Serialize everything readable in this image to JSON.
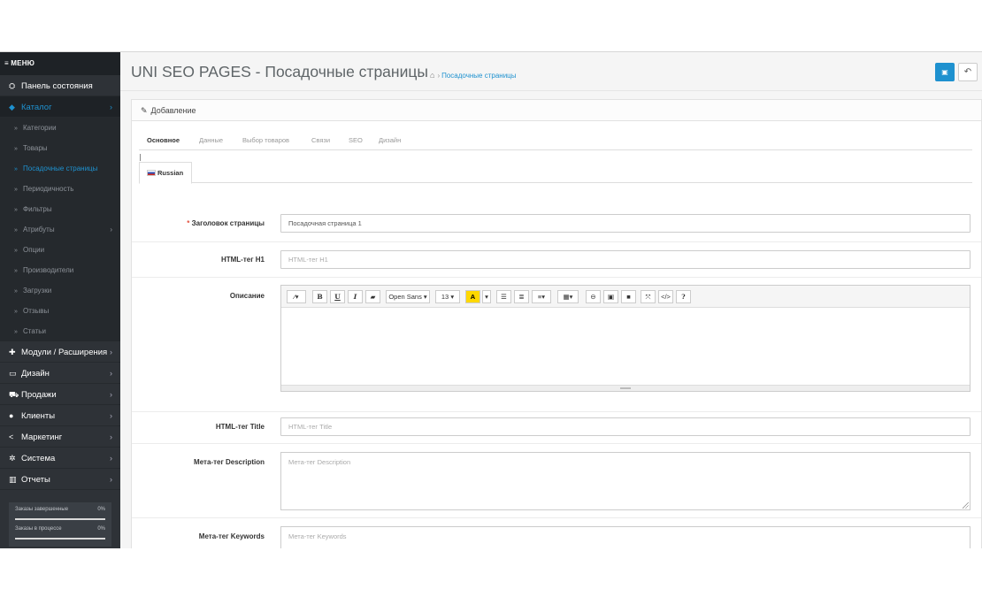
{
  "sidebar": {
    "menu_label": "≡ МЕНЮ",
    "items": [
      {
        "label": "Панель состояния",
        "icon": "dashboard-icon",
        "glyph": "⛭"
      },
      {
        "label": "Каталог",
        "icon": "tag-icon",
        "glyph": "◆",
        "active": true
      },
      {
        "label": "Модули / Расширения",
        "icon": "puzzle-icon",
        "glyph": "✚"
      },
      {
        "label": "Дизайн",
        "icon": "monitor-icon",
        "glyph": "▭"
      },
      {
        "label": "Продажи",
        "icon": "cart-icon",
        "glyph": "⛟"
      },
      {
        "label": "Клиенты",
        "icon": "user-icon",
        "glyph": "●"
      },
      {
        "label": "Маркетинг",
        "icon": "share-icon",
        "glyph": "<"
      },
      {
        "label": "Система",
        "icon": "cog-icon",
        "glyph": "✲"
      },
      {
        "label": "Отчеты",
        "icon": "bar-chart-icon",
        "glyph": "▥"
      }
    ],
    "catalog_sub": [
      "Категории",
      "Товары",
      "Посадочные страницы",
      "Периодичность",
      "Фильтры",
      "Атрибуты",
      "Опции",
      "Производители",
      "Загрузки",
      "Отзывы",
      "Статьи"
    ],
    "stats": [
      {
        "label": "Заказы завершенные",
        "value": "0%"
      },
      {
        "label": "Заказы в процессе",
        "value": "0%"
      }
    ]
  },
  "header": {
    "title": "UNI SEO PAGES - Посадочные страницы",
    "breadcrumb": "Посадочные страницы"
  },
  "panel": {
    "heading": "Добавление",
    "tabs": [
      "Основное",
      "Данные",
      "Выбор товаров",
      "Связи",
      "SEO",
      "Дизайн"
    ],
    "language": "Russian"
  },
  "form": {
    "page_title": {
      "label": "Заголовок страницы",
      "value": "Посадочная страница 1"
    },
    "h1": {
      "label": "HTML-тег H1",
      "placeholder": "HTML-тег H1"
    },
    "description": {
      "label": "Описание"
    },
    "title_tag": {
      "label": "HTML-тег Title",
      "placeholder": "HTML-тег Title"
    },
    "meta_description": {
      "label": "Мета-тег Description",
      "placeholder": "Мета-тег Description"
    },
    "meta_keywords": {
      "label": "Мета-тег Keywords",
      "placeholder": "Мета-тег Keywords"
    }
  },
  "toolbar": {
    "font_name": "Open Sans ▾",
    "font_size": "13 ▾"
  },
  "colors": {
    "accent": "#1e91cf",
    "sidebar": "#2e3237",
    "required": "#e3503e"
  }
}
